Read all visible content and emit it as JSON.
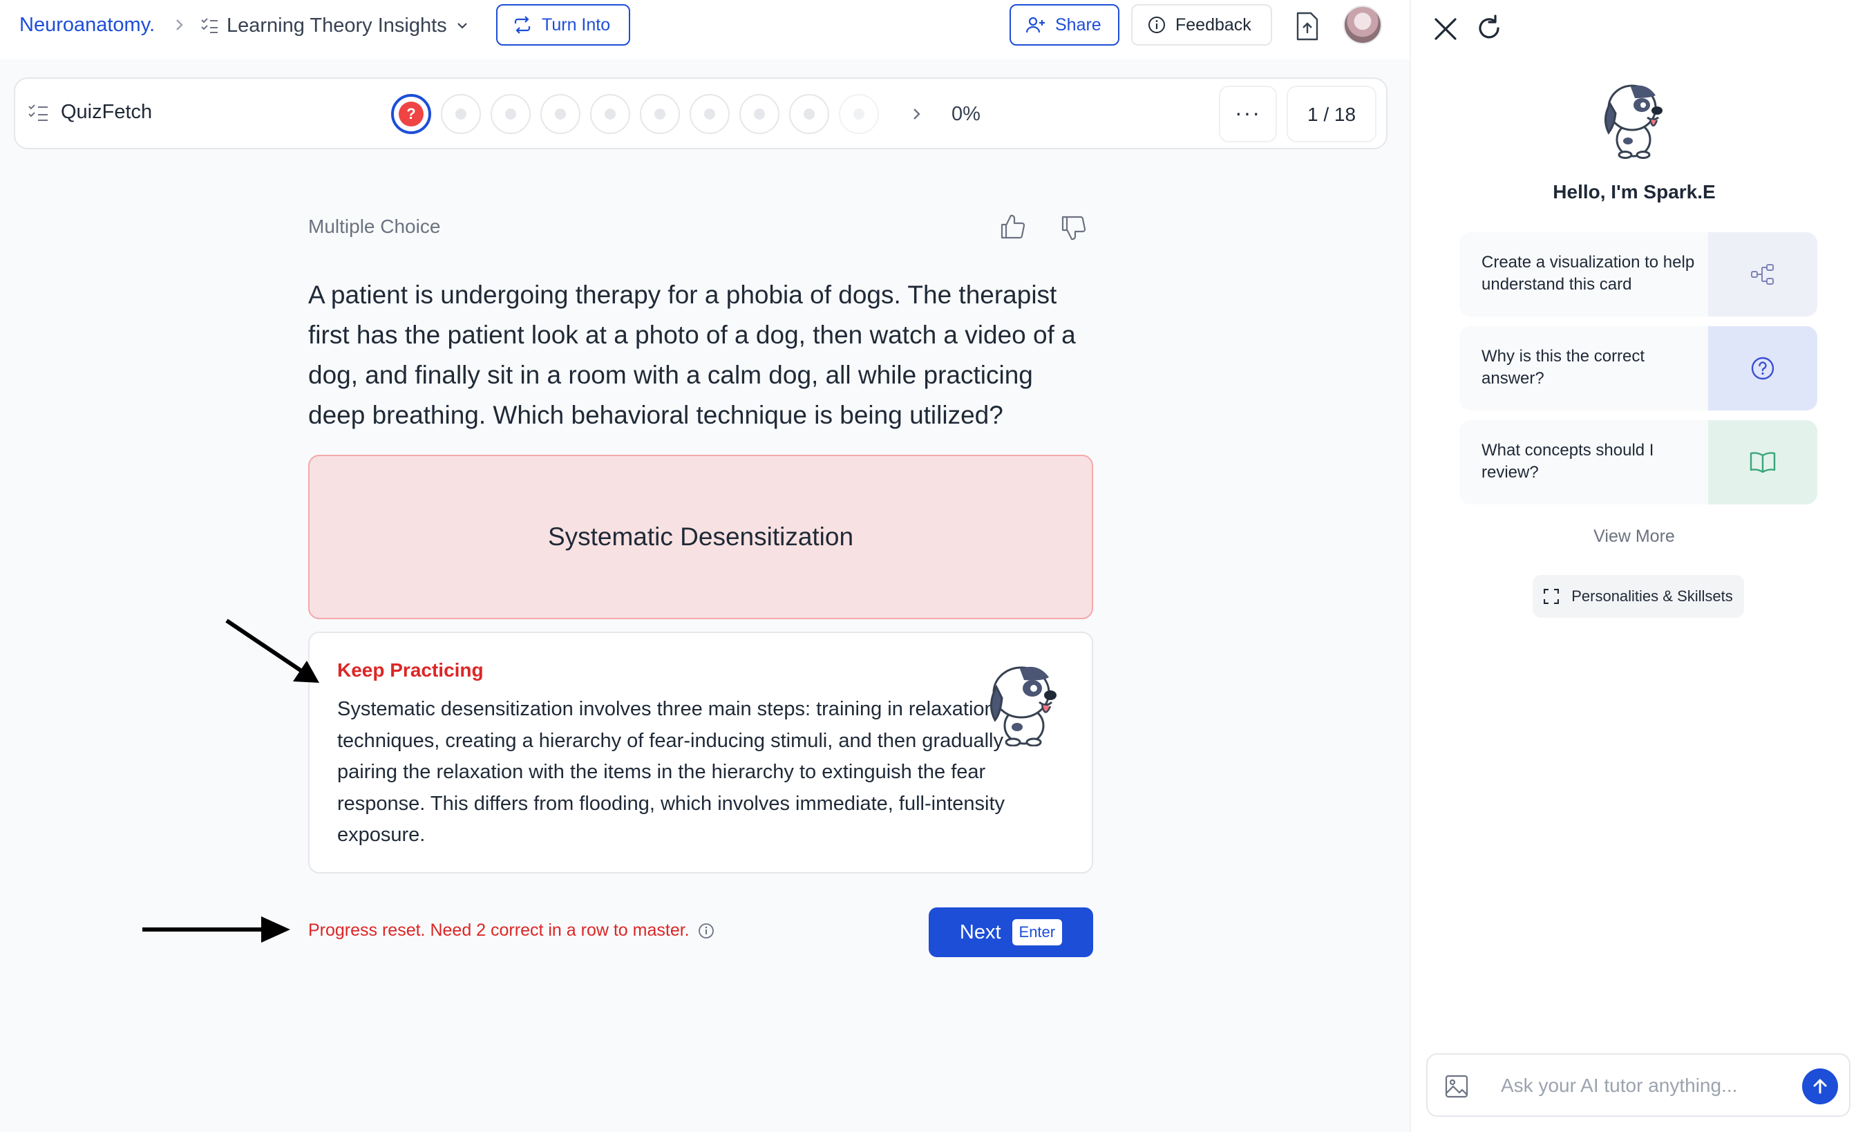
{
  "header": {
    "breadcrumb_root": "Neuroanatomy.",
    "deck_title": "Learning Theory Insights",
    "turn_into_label": "Turn Into",
    "share_label": "Share",
    "feedback_label": "Feedback"
  },
  "quiz_bar": {
    "title": "QuizFetch",
    "progress_percent": "0%",
    "counter": "1 / 18",
    "more_label": "···",
    "dots_total": 9,
    "current_dot_mark": "?"
  },
  "card": {
    "type_label": "Multiple Choice",
    "question": "A patient is undergoing therapy for a phobia of dogs. The therapist first has the patient look at a photo of a dog, then watch a video of a dog, and finally sit in a room with a calm dog, all while practicing deep breathing. Which behavioral technique is being utilized?",
    "selected_answer": "Systematic Desensitization",
    "feedback_title": "Keep Practicing",
    "explanation": "Systematic desensitization involves three main steps: training in relaxation techniques, creating a hierarchy of fear-inducing stimuli, and then gradually pairing the relaxation with the items in the hierarchy to extinguish the fear response. This differs from flooding, which involves immediate, full-intensity exposure.",
    "reset_message": "Progress reset. Need 2 correct in a row to master.",
    "next_label": "Next",
    "next_shortcut": "Enter"
  },
  "side_panel": {
    "greeting": "Hello, I'm Spark.E",
    "suggestions": [
      {
        "label": "Create a visualization to help understand this card",
        "icon": "diagram-icon"
      },
      {
        "label": "Why is this the correct answer?",
        "icon": "question-circle-icon"
      },
      {
        "label": "What concepts should I review?",
        "icon": "book-icon"
      }
    ],
    "view_more": "View More",
    "personalities_label": "Personalities & Skillsets",
    "chat_placeholder": "Ask your AI tutor anything..."
  },
  "colors": {
    "accent": "#1d4ed8",
    "error": "#dc2626",
    "answer_bg": "#f8e1e2"
  }
}
